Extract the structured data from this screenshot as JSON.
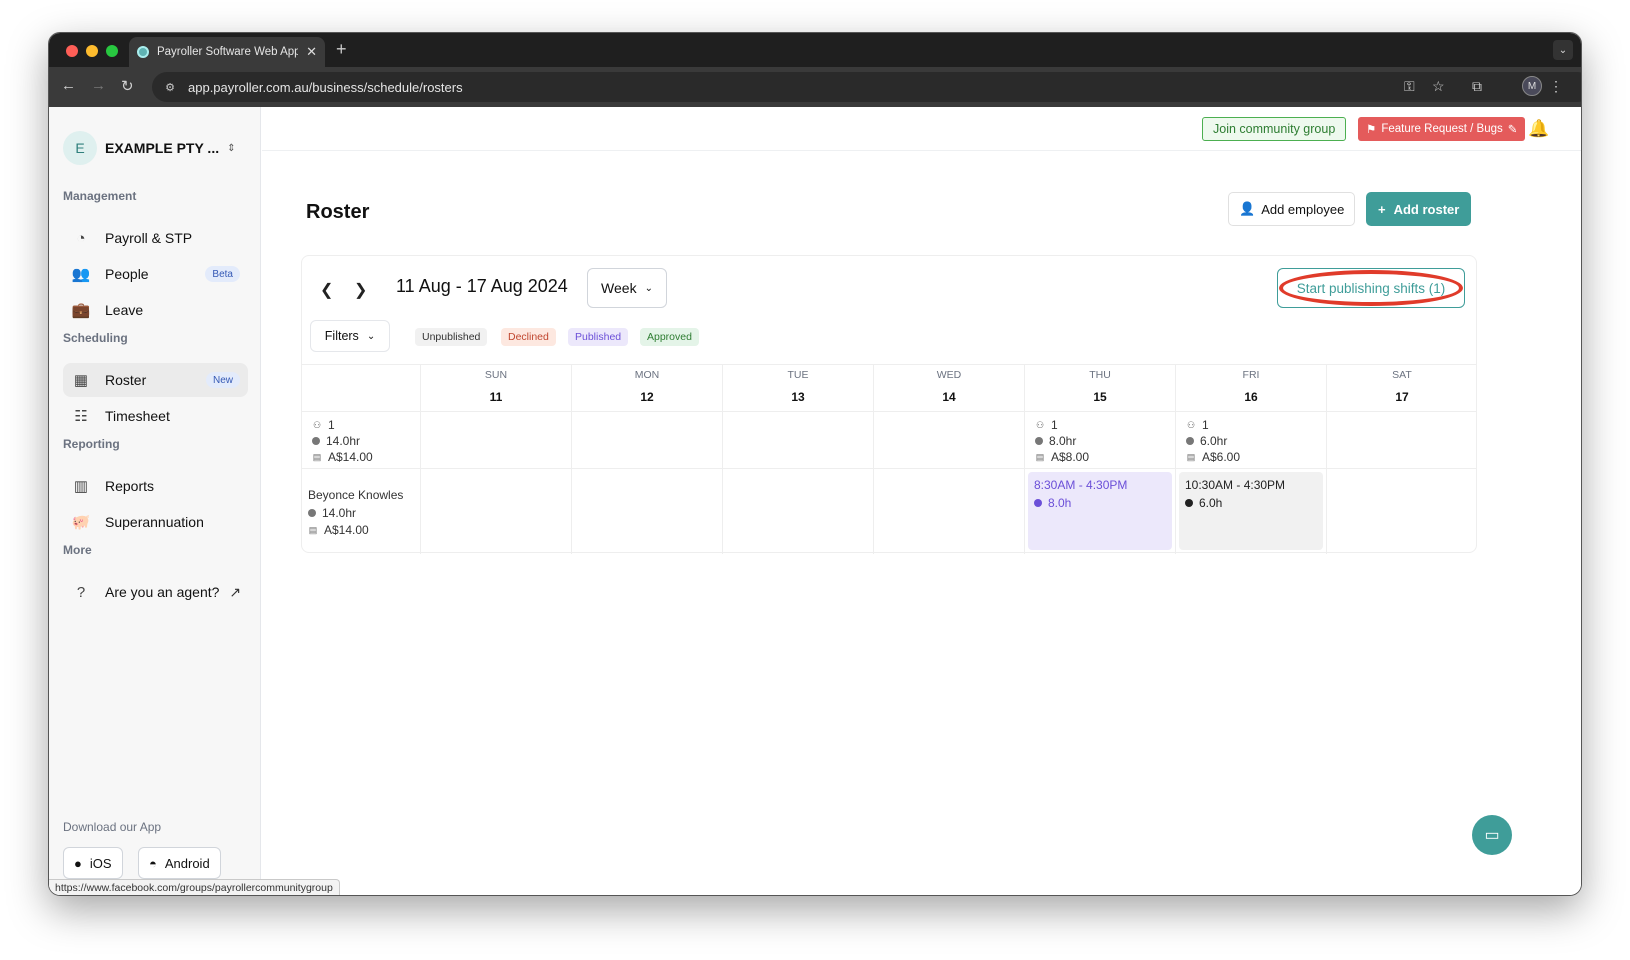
{
  "browser": {
    "tab_title": "Payroller Software Web Appli",
    "tab_close": "✕",
    "new_tab": "+",
    "url": "app.payroller.com.au/business/schedule/rosters",
    "profile_initial": "M",
    "status_url": "https://www.facebook.com/groups/payrollercommunitygroup"
  },
  "sidebar": {
    "org_initial": "E",
    "org_name": "EXAMPLE PTY ...",
    "sections": {
      "management": "Management",
      "scheduling": "Scheduling",
      "reporting": "Reporting",
      "more": "More"
    },
    "items": [
      {
        "label": "Payroll & STP",
        "icon": "payroll-icon"
      },
      {
        "label": "People",
        "icon": "people-icon",
        "badge": "Beta"
      },
      {
        "label": "Leave",
        "icon": "briefcase-icon"
      },
      {
        "label": "Roster",
        "icon": "calendar-icon",
        "badge": "New",
        "active": true
      },
      {
        "label": "Timesheet",
        "icon": "timesheet-icon"
      },
      {
        "label": "Reports",
        "icon": "reports-icon"
      },
      {
        "label": "Superannuation",
        "icon": "piggy-bank-icon"
      },
      {
        "label": "Are you an agent?",
        "icon": "help-icon"
      }
    ],
    "download_title": "Download our App",
    "ios_label": "iOS",
    "android_label": "Android"
  },
  "topbar": {
    "community_label": "Join community group",
    "feature_label": "Feature Request / Bugs"
  },
  "page": {
    "title": "Roster",
    "add_employee_label": "Add employee",
    "add_roster_label": "Add roster"
  },
  "roster": {
    "date_range": "11 Aug - 17 Aug 2024",
    "view_select": "Week",
    "publish_label": "Start publishing shifts (1)",
    "filters_label": "Filters",
    "legend": {
      "unpublished": "Unpublished",
      "declined": "Declined",
      "published": "Published",
      "approved": "Approved"
    },
    "days": [
      {
        "name": "SUN",
        "num": "11"
      },
      {
        "name": "MON",
        "num": "12"
      },
      {
        "name": "TUE",
        "num": "13"
      },
      {
        "name": "WED",
        "num": "14"
      },
      {
        "name": "THU",
        "num": "15"
      },
      {
        "name": "FRI",
        "num": "16"
      },
      {
        "name": "SAT",
        "num": "17"
      }
    ],
    "summary": {
      "total": {
        "count": "1",
        "hours": "14.0hr",
        "cost": "A$14.00"
      },
      "thu": {
        "count": "1",
        "hours": "8.0hr",
        "cost": "A$8.00"
      },
      "fri": {
        "count": "1",
        "hours": "6.0hr",
        "cost": "A$6.00"
      }
    },
    "employee": {
      "name": "Beyonce Knowles",
      "hours": "14.0hr",
      "cost": "A$14.00"
    },
    "shifts": {
      "thu": {
        "time": "8:30AM - 4:30PM",
        "hours": "8.0h"
      },
      "fri": {
        "time": "10:30AM - 4:30PM",
        "hours": "6.0h"
      }
    }
  },
  "colors": {
    "brand_teal": "#3f9d99",
    "published_purple": "#6b4fd8",
    "annotation_red": "#e03b2a"
  }
}
